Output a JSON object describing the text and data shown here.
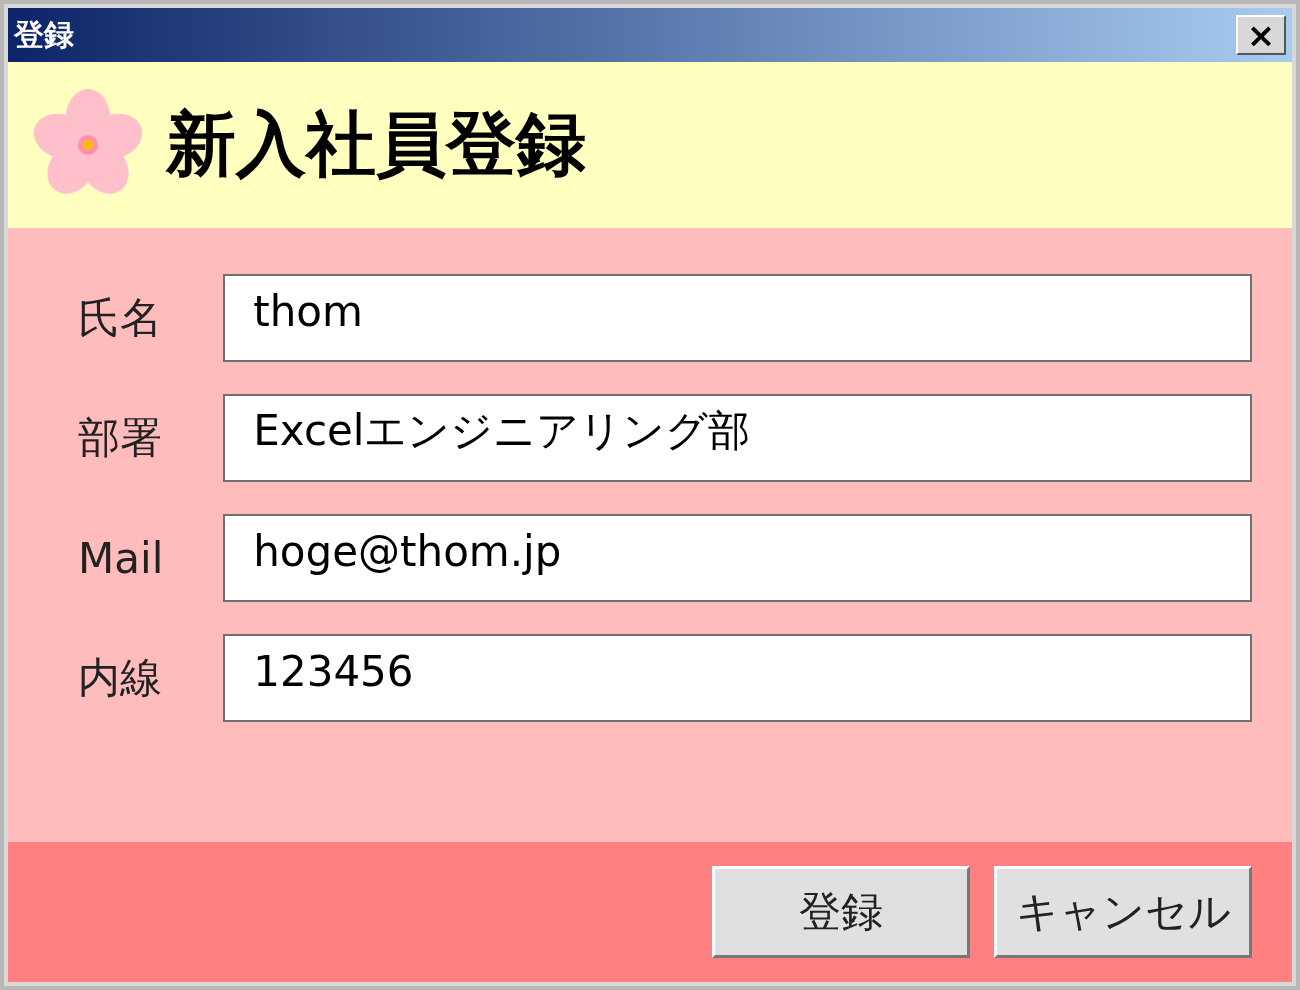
{
  "window": {
    "title": "登録",
    "close": "×"
  },
  "header": {
    "title": "新入社員登録"
  },
  "fields": [
    {
      "label": "氏名",
      "value": "thom"
    },
    {
      "label": "部署",
      "value": "Excelエンジニアリング部"
    },
    {
      "label": "Mail",
      "value": "hoge@thom.jp"
    },
    {
      "label": "内線",
      "value": "123456"
    }
  ],
  "buttons": [
    "登録",
    "キャンセル"
  ]
}
